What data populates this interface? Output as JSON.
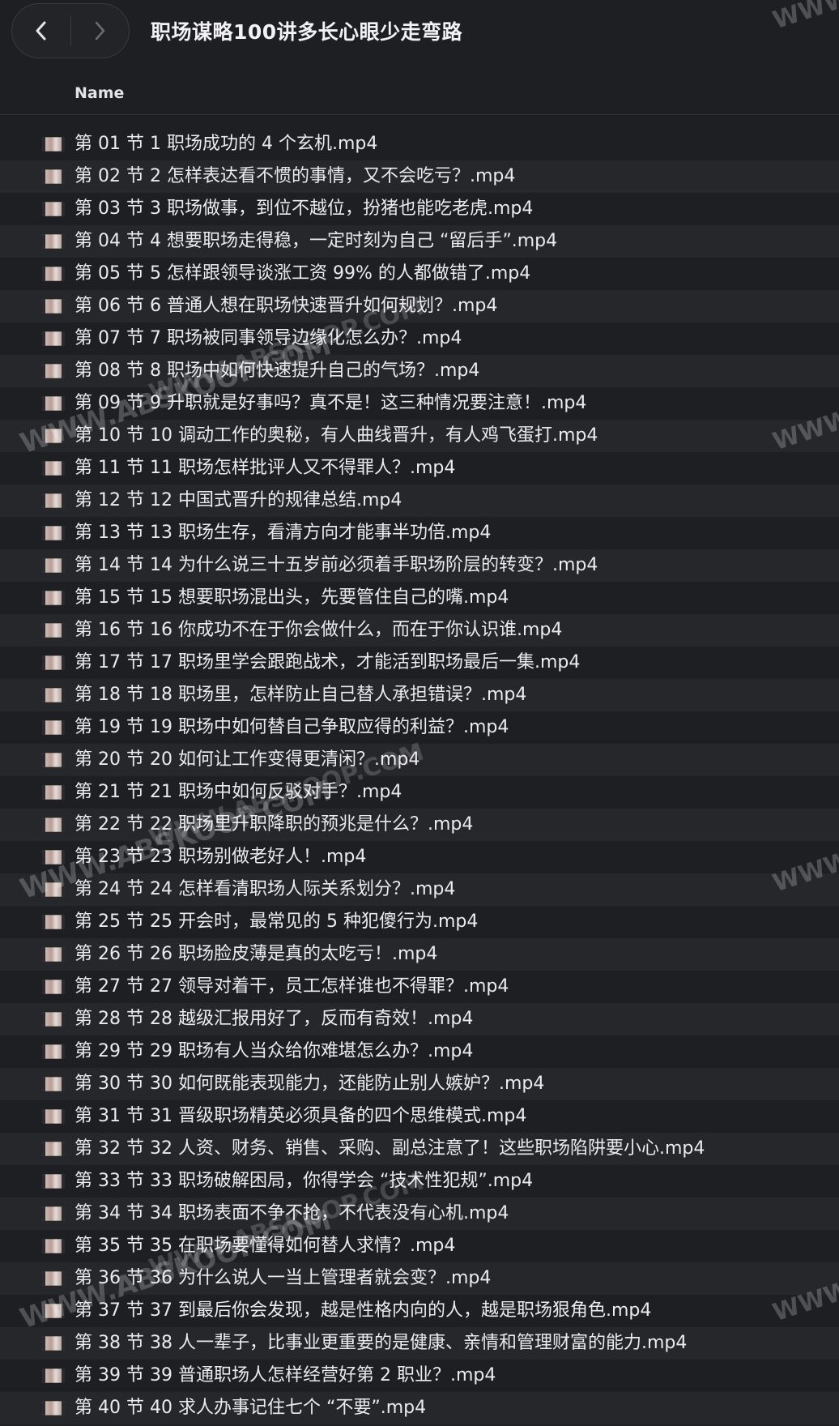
{
  "window": {
    "title": "职场谋略100讲多长心眼少走弯路",
    "back_icon": "chevron-left-icon",
    "forward_icon": "chevron-right-icon"
  },
  "columns": {
    "name_label": "Name"
  },
  "files": [
    {
      "name": "第 01 节 1 职场成功的 4 个玄机.mp4"
    },
    {
      "name": "第 02 节 2 怎样表达看不惯的事情，又不会吃亏？.mp4"
    },
    {
      "name": "第 03 节 3 职场做事，到位不越位，扮猪也能吃老虎.mp4"
    },
    {
      "name": "第 04 节 4 想要职场走得稳，一定时刻为自己 “留后手”.mp4"
    },
    {
      "name": "第 05 节 5 怎样跟领导谈涨工资 99% 的人都做错了.mp4"
    },
    {
      "name": "第 06 节 6 普通人想在职场快速晋升如何规划？.mp4"
    },
    {
      "name": "第 07 节 7 职场被同事领导边缘化怎么办？.mp4"
    },
    {
      "name": "第 08 节 8 职场中如何快速提升自己的气场？.mp4"
    },
    {
      "name": "第 09 节 9 升职就是好事吗？真不是！这三种情况要注意！.mp4"
    },
    {
      "name": "第 10 节 10 调动工作的奥秘，有人曲线晋升，有人鸡飞蛋打.mp4"
    },
    {
      "name": "第 11 节 11 职场怎样批评人又不得罪人？.mp4"
    },
    {
      "name": "第 12 节 12 中国式晋升的规律总结.mp4"
    },
    {
      "name": "第 13 节 13 职场生存，看清方向才能事半功倍.mp4"
    },
    {
      "name": "第 14 节 14 为什么说三十五岁前必须着手职场阶层的转变？.mp4"
    },
    {
      "name": "第 15 节 15 想要职场混出头，先要管住自己的嘴.mp4"
    },
    {
      "name": "第 16 节 16 你成功不在于你会做什么，而在于你认识谁.mp4"
    },
    {
      "name": "第 17 节 17 职场里学会跟跑战术，才能活到职场最后一集.mp4"
    },
    {
      "name": "第 18 节 18 职场里，怎样防止自己替人承担错误？.mp4"
    },
    {
      "name": "第 19 节 19 职场中如何替自己争取应得的利益？.mp4"
    },
    {
      "name": "第 20 节 20 如何让工作变得更清闲？.mp4"
    },
    {
      "name": "第 21 节 21 职场中如何反驳对手？.mp4"
    },
    {
      "name": "第 22 节 22 职场里升职降职的预兆是什么？.mp4"
    },
    {
      "name": "第 23 节 23 职场别做老好人！.mp4"
    },
    {
      "name": "第 24 节 24 怎样看清职场人际关系划分？.mp4"
    },
    {
      "name": "第 25 节 25 开会时，最常见的 5 种犯傻行为.mp4"
    },
    {
      "name": "第 26 节 26 职场脸皮薄是真的太吃亏！.mp4"
    },
    {
      "name": "第 27 节 27 领导对着干，员工怎样谁也不得罪？.mp4"
    },
    {
      "name": "第 28 节 28 越级汇报用好了，反而有奇效！.mp4"
    },
    {
      "name": "第 29 节 29 职场有人当众给你难堪怎么办？.mp4"
    },
    {
      "name": "第 30 节 30 如何既能表现能力，还能防止别人嫉妒？.mp4"
    },
    {
      "name": "第 31 节 31 晋级职场精英必须具备的四个思维模式.mp4"
    },
    {
      "name": "第 32 节 32 人资、财务、销售、采购、副总注意了！这些职场陷阱要小心.mp4"
    },
    {
      "name": "第 33 节 33 职场破解困局，你得学会 “技术性犯规”.mp4"
    },
    {
      "name": "第 34 节 34 职场表面不争不抢，不代表没有心机.mp4"
    },
    {
      "name": "第 35 节 35 在职场要懂得如何替人求情？.mp4"
    },
    {
      "name": "第 36 节 36 为什么说人一当上管理者就会变？.mp4"
    },
    {
      "name": "第 37 节 37 到最后你会发现，越是性格内向的人，越是职场狠角色.mp4"
    },
    {
      "name": "第 38 节 38 人一辈子，比事业更重要的是健康、亲情和管理财富的能力.mp4"
    },
    {
      "name": "第 39 节 39 普通职场人怎样经营好第 2 职业？.mp4"
    },
    {
      "name": "第 40 节 40 求人办事记住七个 “不要”.mp4"
    }
  ],
  "watermarks": [
    {
      "text": "WWW.ABSKOOP.COM"
    },
    {
      "text": "WWW.ABSKOOP.COM"
    },
    {
      "text": "WWW.ABSKOOP.COM"
    },
    {
      "text": "WWW.ABSKOOP.COM"
    },
    {
      "text": "WWW.ABSKOOP.COM"
    },
    {
      "text": "WWW.ABSKOOP.COM"
    },
    {
      "text": "WWW.ABSKOOP.COM"
    }
  ],
  "colors": {
    "background": "#1e1f23",
    "row_alt": "#26272b",
    "text": "#ebebed"
  }
}
